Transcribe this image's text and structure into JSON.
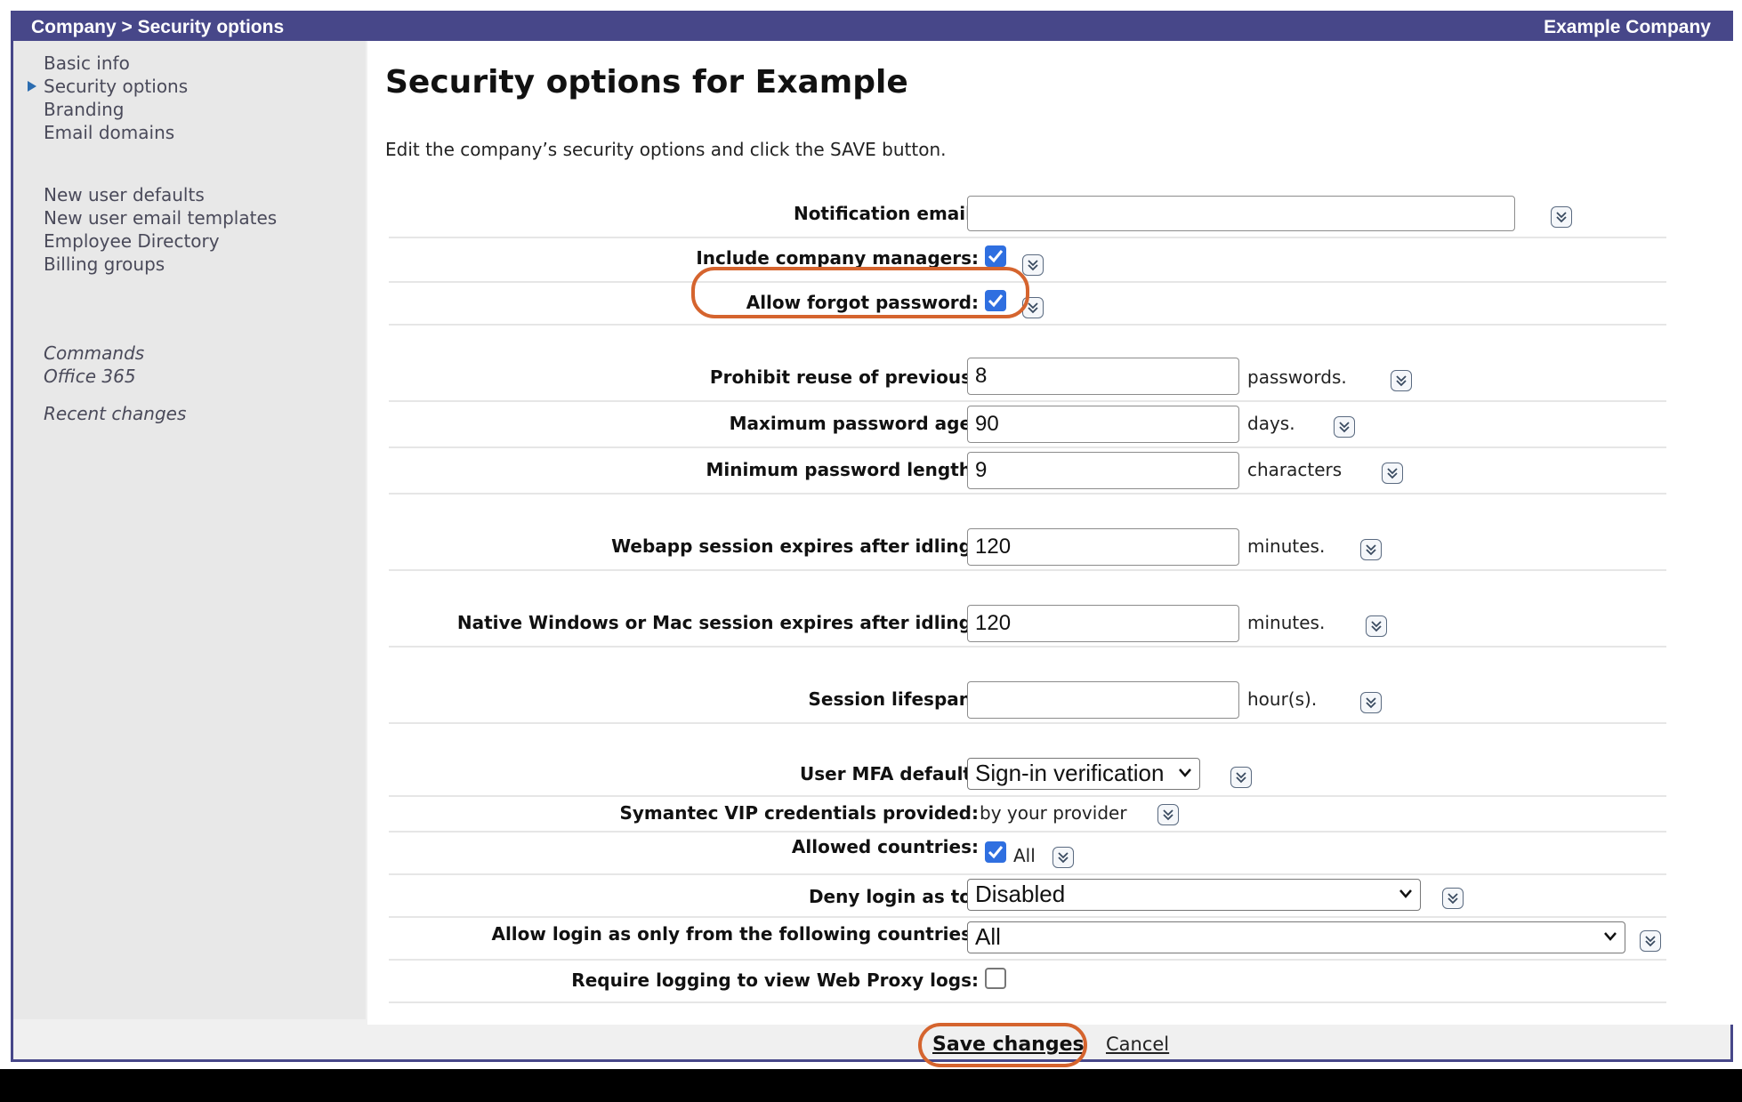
{
  "header": {
    "breadcrumb": "Company > Security options",
    "company": "Example Company"
  },
  "sidebar": {
    "group1": [
      "Basic info",
      "Security options",
      "Branding",
      "Email domains"
    ],
    "group2": [
      "New user defaults",
      "New user email templates",
      "Employee Directory",
      "Billing groups"
    ],
    "commands": "Commands",
    "office365": "Office 365",
    "recent": "Recent changes",
    "active_item": "Security options"
  },
  "main": {
    "title": "Security options for Example",
    "intro": "Edit the company’s security options and click the SAVE button."
  },
  "form": {
    "notification_email": {
      "label": "Notification email:",
      "value": ""
    },
    "include_managers": {
      "label": "Include company managers:",
      "checked": true
    },
    "allow_forgot": {
      "label": "Allow forgot password:",
      "checked": true
    },
    "prohibit_reuse": {
      "label": "Prohibit reuse of previous:",
      "value": "8",
      "unit": "passwords."
    },
    "max_age": {
      "label": "Maximum password age:",
      "value": "90",
      "unit": "days."
    },
    "min_length": {
      "label": "Minimum password length:",
      "value": "9",
      "unit": "characters"
    },
    "webapp_session": {
      "label": "Webapp session expires after idling:",
      "value": "120",
      "unit": "minutes."
    },
    "native_session": {
      "label": "Native Windows or Mac session expires after idling:",
      "value": "120",
      "unit": "minutes."
    },
    "session_lifespan": {
      "label": "Session lifespan:",
      "value": "",
      "unit": "hour(s)."
    },
    "mfa_default": {
      "label": "User MFA default:",
      "value": "Sign-in verification"
    },
    "symantec_vip": {
      "label": "Symantec VIP credentials provided:",
      "value": "by your provider"
    },
    "allowed_countries": {
      "label": "Allowed countries:",
      "checked": true,
      "value": "All"
    },
    "deny_login_as": {
      "label": "Deny login as to:",
      "value": "Disabled"
    },
    "allow_login_countries": {
      "label": "Allow login as only from the following countries:",
      "value": "All"
    },
    "require_logging": {
      "label": "Require logging to view Web Proxy logs:",
      "checked": false
    }
  },
  "footer": {
    "save": "Save changes",
    "cancel": "Cancel"
  },
  "colors": {
    "header": "#474789",
    "checkbox": "#2f6fe0",
    "highlight": "#d5642e"
  }
}
